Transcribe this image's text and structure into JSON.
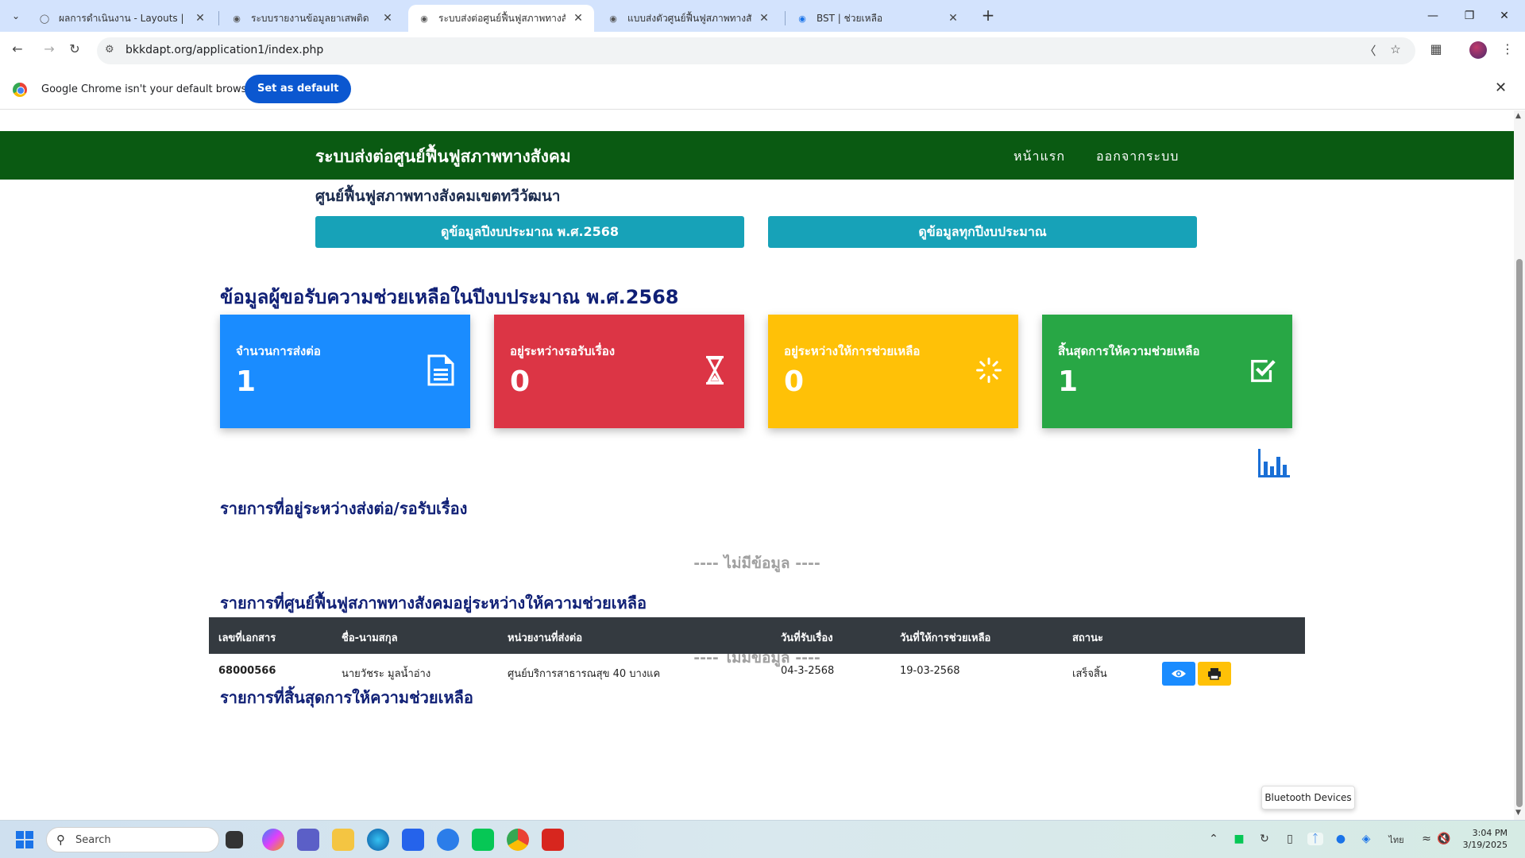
{
  "browser": {
    "tabs": [
      {
        "title": "ผลการดำเนินงาน - Layouts | Nisp"
      },
      {
        "title": "ระบบรายงานข้อมูลยาเสพติด"
      },
      {
        "title": "ระบบส่งต่อศูนย์ฟื้นฟูสภาพทางสังคม"
      },
      {
        "title": "แบบส่งตัวศูนย์ฟื้นฟูสภาพทางสังคม"
      },
      {
        "title": "BST | ช่วยเหลือ"
      }
    ],
    "url": "bkkdapt.org/application1/index.php",
    "infobar_message": "Google Chrome isn't your default browser",
    "infobar_button": "Set as default"
  },
  "site": {
    "brand": "ระบบส่งต่อศูนย์ฟื้นฟูสภาพทางสังคม",
    "nav": {
      "home": "หน้าแรก",
      "logout": "ออกจากระบบ"
    },
    "center_name": "ศูนย์ฟื้นฟูสภาพทางสังคมเขตทวีวัฒนา",
    "btn_year": "ดูข้อมูลปีงบประมาณ พ.ศ.2568",
    "btn_all": "ดูข้อมูลทุกปีงบประมาณ",
    "section_title": "ข้อมูลผู้ขอรับความช่วยเหลือในปีงบประมาณ พ.ศ.2568",
    "cards": [
      {
        "label": "จำนวนการส่งต่อ",
        "value": "1",
        "color": "#1a8cff"
      },
      {
        "label": "อยู่ระหว่างรอรับเรื่อง",
        "value": "0",
        "color": "#dc3545"
      },
      {
        "label": "อยู่ระหว่างให้การช่วยเหลือ",
        "value": "0",
        "color": "#ffc107"
      },
      {
        "label": "สิ้นสุดการให้ความช่วยเหลือ",
        "value": "1",
        "color": "#28a745"
      }
    ],
    "list1_title": "รายการที่อยู่ระหว่างส่งต่อ/รอรับเรื่อง",
    "list2_title": "รายการที่ศูนย์ฟื้นฟูสภาพทางสังคมอยู่ระหว่างให้ความช่วยเหลือ",
    "list3_title": "รายการที่สิ้นสุดการให้ความช่วยเหลือ",
    "no_data": "---- ไม่มีข้อมูล ----",
    "table": {
      "headers": [
        "เลขที่เอกสาร",
        "ชื่อ-นามสกุล",
        "หน่วยงานที่ส่งต่อ",
        "วันที่รับเรื่อง",
        "วันที่ให้การช่วยเหลือ",
        "สถานะ"
      ],
      "rows": [
        [
          "68000566",
          "นายวัชระ มูลน้ำอ่าง",
          "ศูนย์บริการสาธารณสุข 40 บางแค",
          "04-3-2568",
          "19-03-2568",
          "เสร็จสิ้น"
        ]
      ]
    }
  },
  "tooltip": "Bluetooth Devices",
  "taskbar": {
    "search_placeholder": "Search",
    "lang": "ไทย",
    "time": "3:04 PM",
    "date": "3/19/2025"
  }
}
